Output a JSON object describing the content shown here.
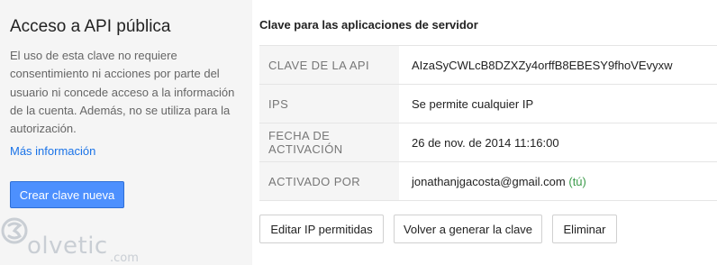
{
  "left": {
    "title": "Acceso a API pública",
    "description": "El uso de esta clave no requiere consentimiento ni acciones por parte del usuario ni concede acceso a la información de la cuenta. Además, no se utiliza para la autorización.",
    "more_link": "Más información",
    "create_button": "Crear clave nueva"
  },
  "logo": {
    "text": "olvetic",
    "domain": ".com"
  },
  "main": {
    "title": "Clave para las aplicaciones de servidor",
    "rows": [
      {
        "label": "CLAVE DE LA API",
        "value": "AIzaSyCWLcB8DZXZy4orffB8EBESY9fhoVEvyxw"
      },
      {
        "label": "IPS",
        "value": "Se permite cualquier IP"
      },
      {
        "label": "FECHA DE ACTIVACIÓN",
        "value": "26 de nov. de 2014 11:16:00"
      },
      {
        "label": "ACTIVADO POR",
        "value": "jonathanjgacosta@gmail.com",
        "suffix": "(tú)"
      }
    ],
    "buttons": {
      "edit_ips": "Editar IP permitidas",
      "regenerate": "Volver a generar la clave",
      "delete": "Eliminar"
    }
  },
  "colors": {
    "accent": "#4d90fe",
    "link": "#1a73e8",
    "you_label": "#3c9b4b",
    "panel_bg": "#f5f5f5"
  }
}
